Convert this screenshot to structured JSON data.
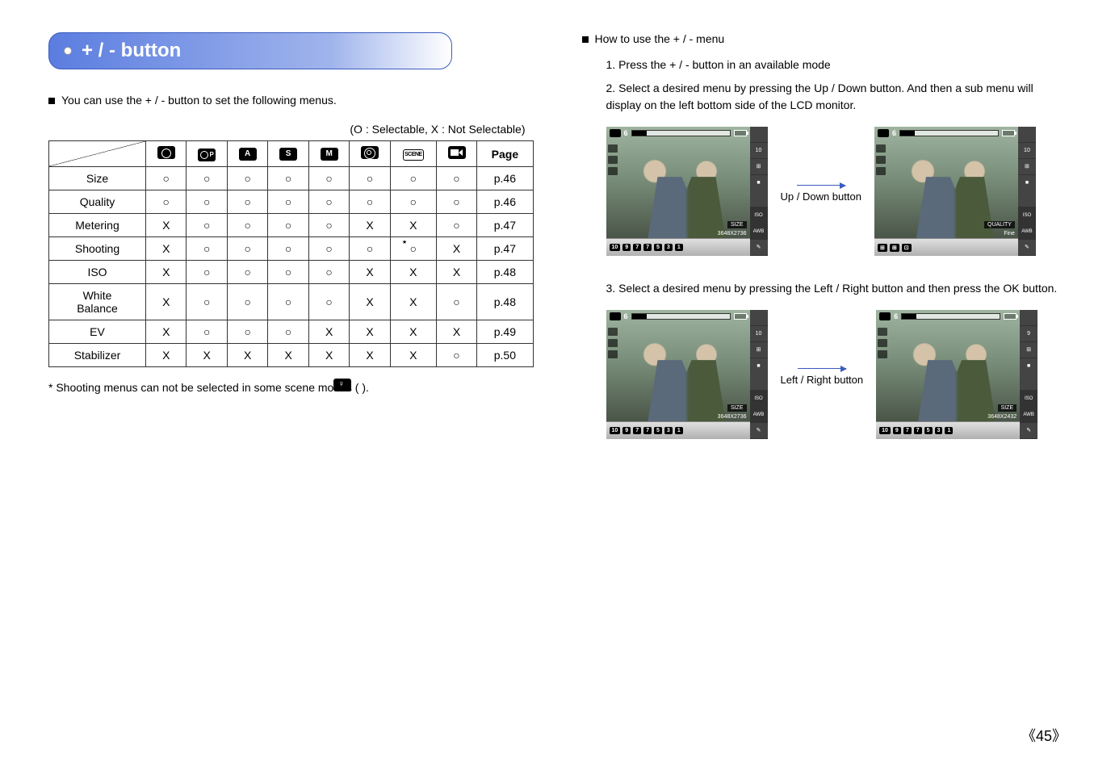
{
  "title": "+ / - button",
  "left": {
    "intro": "You can use the + / - button to set the following menus.",
    "legend": "(O : Selectable, X : Not Selectable)",
    "page_hdr": "Page",
    "rows": [
      {
        "name": "Size",
        "v": [
          "○",
          "○",
          "○",
          "○",
          "○",
          "○",
          "○",
          "○"
        ],
        "page": "p.46"
      },
      {
        "name": "Quality",
        "v": [
          "○",
          "○",
          "○",
          "○",
          "○",
          "○",
          "○",
          "○"
        ],
        "page": "p.46"
      },
      {
        "name": "Metering",
        "v": [
          "X",
          "○",
          "○",
          "○",
          "○",
          "X",
          "X",
          "○"
        ],
        "page": "p.47"
      },
      {
        "name": "Shooting",
        "v": [
          "X",
          "○",
          "○",
          "○",
          "○",
          "○",
          "*○",
          "X"
        ],
        "page": "p.47"
      },
      {
        "name": "ISO",
        "v": [
          "X",
          "○",
          "○",
          "○",
          "○",
          "X",
          "X",
          "X"
        ],
        "page": "p.48"
      },
      {
        "name": "White Balance",
        "v": [
          "X",
          "○",
          "○",
          "○",
          "○",
          "X",
          "X",
          "○"
        ],
        "page": "p.48"
      },
      {
        "name": "EV",
        "v": [
          "X",
          "○",
          "○",
          "○",
          "X",
          "X",
          "X",
          "X"
        ],
        "page": "p.49"
      },
      {
        "name": "Stabilizer",
        "v": [
          "X",
          "X",
          "X",
          "X",
          "X",
          "X",
          "X",
          "○"
        ],
        "page": "p.50"
      }
    ],
    "footnote": "* Shooting menus can not be selected in some scene modes (         )."
  },
  "right": {
    "heading": "How to use the + / - menu",
    "step1": "1. Press the + / - button in an available mode",
    "step2": "2. Select a desired menu by pressing the Up / Down button. And then a sub menu will display on the left bottom side of the LCD monitor.",
    "step3": "3. Select a desired menu by pressing the Left / Right button and then press the OK button.",
    "arrow1": "Up / Down button",
    "arrow2": "Left / Right button",
    "preview_sizes": [
      "10",
      "9",
      "7",
      "7",
      "5",
      "3",
      "1"
    ],
    "preview_size_label": "SIZE",
    "preview_quality_label": "QUALITY",
    "preview_info1": "3648X2736",
    "preview_info2": "3648X2432",
    "preview_fine": "Fine",
    "preview_top_n": "6",
    "preview_side_10m": "10",
    "preview_side_iso": "ISO",
    "preview_side_awb": "AWB",
    "preview_bottom_first": "10",
    "mode_letters": {
      "A": "A",
      "S": "S",
      "M": "M",
      "P": "P"
    }
  },
  "page_number": "45"
}
